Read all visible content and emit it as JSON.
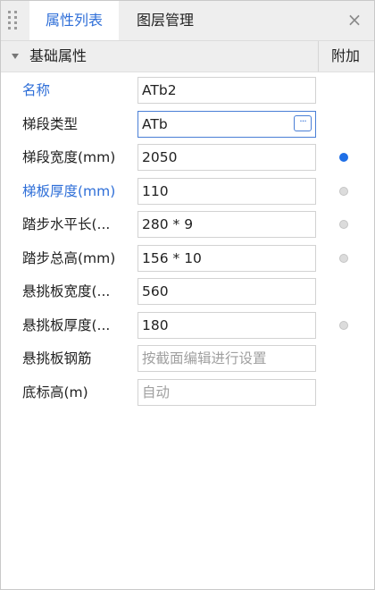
{
  "tabs": [
    {
      "label": "属性列表",
      "active": true
    },
    {
      "label": "图层管理",
      "active": false
    }
  ],
  "close_label": "×",
  "group": {
    "title": "基础属性",
    "attach_header": "附加"
  },
  "rows": [
    {
      "label": "名称",
      "value": "ATb2",
      "placeholder": false,
      "label_highlight": true,
      "attach": "none"
    },
    {
      "label": "梯段类型",
      "value": "ATb",
      "placeholder": false,
      "label_highlight": false,
      "attach": "none",
      "more_button": "···"
    },
    {
      "label": "梯段宽度(mm)",
      "value": "2050",
      "placeholder": false,
      "label_highlight": false,
      "attach": "on"
    },
    {
      "label": "梯板厚度(mm)",
      "value": "110",
      "placeholder": false,
      "label_highlight": true,
      "attach": "off"
    },
    {
      "label": "踏步水平长(...",
      "value": "280 * 9",
      "placeholder": false,
      "label_highlight": false,
      "attach": "off"
    },
    {
      "label": "踏步总高(mm)",
      "value": "156 * 10",
      "placeholder": false,
      "label_highlight": false,
      "attach": "off"
    },
    {
      "label": "悬挑板宽度(...",
      "value": "560",
      "placeholder": false,
      "label_highlight": false,
      "attach": "none"
    },
    {
      "label": "悬挑板厚度(...",
      "value": "180",
      "placeholder": false,
      "label_highlight": false,
      "attach": "off"
    },
    {
      "label": "悬挑板钢筋",
      "value": "按截面编辑进行设置",
      "placeholder": true,
      "label_highlight": false,
      "attach": "none"
    },
    {
      "label": "底标高(m)",
      "value": "自动",
      "placeholder": true,
      "label_highlight": false,
      "attach": "none"
    }
  ],
  "colors": {
    "accent": "#2f6fd8",
    "toggle_on": "#1f6fe6",
    "toggle_off": "#dcdcdc",
    "tab_bg": "#eeeeee"
  }
}
